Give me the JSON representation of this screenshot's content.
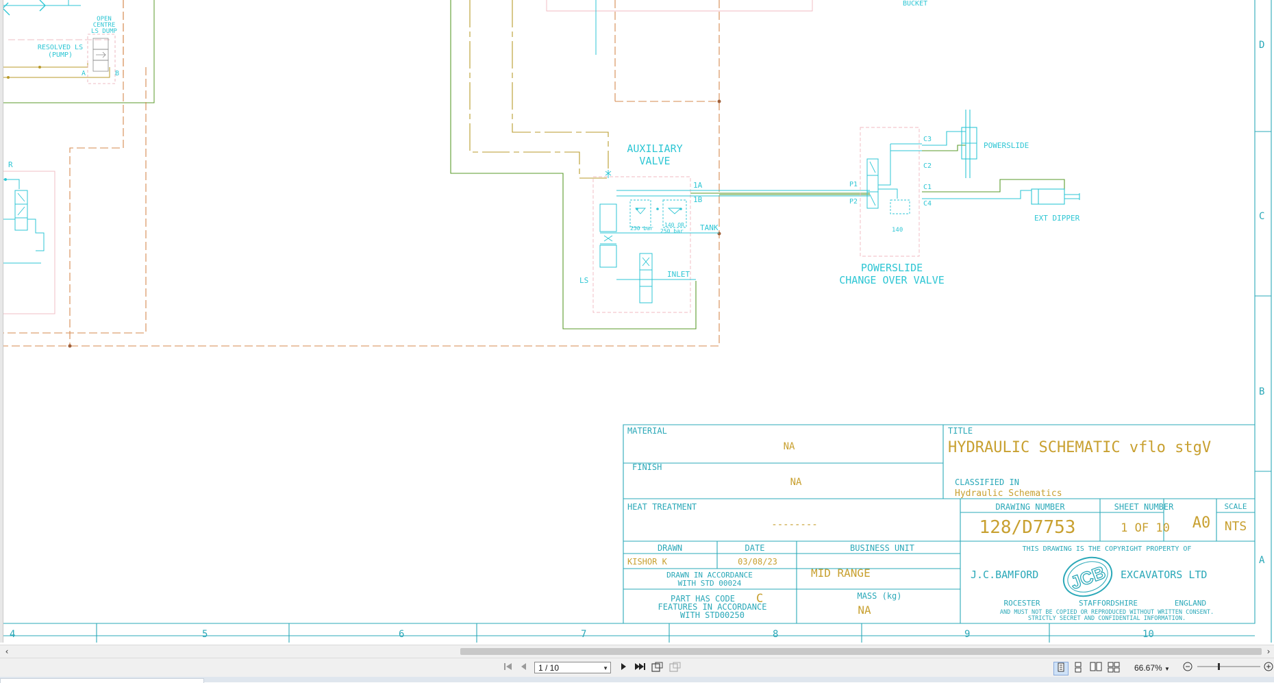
{
  "colors": {
    "cyan": "#2ec6d4",
    "green": "#5a9a2a",
    "orange_dash": "#d4884e",
    "olive": "#b89a2a",
    "frame": "#2aa8b8",
    "pink": "#f0b8c0",
    "title_text": "#c8a030"
  },
  "schematic": {
    "labels": {
      "bucket": "BUCKET",
      "open_centre_1": "OPEN",
      "open_centre_2": "CENTRE",
      "open_centre_3": "LS DUMP",
      "resolved_ls_1": "RESOLVED LS",
      "resolved_ls_2": "(PUMP)",
      "port_a": "A",
      "port_b": "B",
      "r": "R",
      "aux_valve_1": "AUXILIARY",
      "aux_valve_2": "VALVE",
      "port_1a": "1A",
      "port_1b": "1B",
      "tank": "TANK",
      "inlet": "INLET",
      "ls": "LS",
      "relief_1": "250 bar",
      "relief_2a": "140 OR",
      "relief_2b": "250 bar",
      "powerslide": "POWERSLIDE",
      "ext_dipper": "EXT DIPPER",
      "c3": "C3",
      "c2": "C2",
      "c1": "C1",
      "c4": "C4",
      "p1": "P1",
      "p2": "P2",
      "v140": "140",
      "co_valve_1": "POWERSLIDE",
      "co_valve_2": "CHANGE OVER VALVE"
    }
  },
  "grid": {
    "columns": [
      "4",
      "5",
      "6",
      "7",
      "8",
      "9",
      "10"
    ],
    "rows": [
      "D",
      "C",
      "B",
      "A"
    ]
  },
  "title_block": {
    "material_label": "MATERIAL",
    "material_value": "NA",
    "finish_label": "FINISH",
    "finish_value": "NA",
    "heat_label": "HEAT TREATMENT",
    "heat_value": "--------",
    "drawn_label": "DRAWN",
    "drawn_value": "KISHOR K",
    "date_label": "DATE",
    "date_value": "03/08/23",
    "bu_label": "BUSINESS UNIT",
    "bu_value": "MID RANGE",
    "accordance_1": "DRAWN IN ACCORDANCE",
    "accordance_2": "WITH STD 00024",
    "part_code_label": "PART HAS CODE",
    "part_code_value": "C",
    "features_1": "FEATURES IN ACCORDANCE",
    "features_2": "WITH STD00250",
    "mass_label": "MASS (kg)",
    "mass_value": "NA",
    "title_label": "TITLE",
    "title_value": "HYDRAULIC SCHEMATIC vflo stgV",
    "classified_label": "CLASSIFIED IN",
    "classified_value": "Hydraulic Schematics",
    "drawing_number_label": "DRAWING NUMBER",
    "drawing_number_value": "128/D7753",
    "sheet_number_label": "SHEET NUMBER",
    "sheet_number_value": "1 OF 10",
    "size_value": "A0",
    "scale_label": "SCALE",
    "scale_value": "NTS",
    "copyright_line": "THIS DRAWING IS THE COPYRIGHT PROPERTY OF",
    "company_left": "J.C.BAMFORD",
    "company_right": "EXCAVATORS LTD",
    "logo_text": "JCB",
    "address_1": "ROCESTER",
    "address_2": "STAFFORDSHIRE",
    "address_3": "ENGLAND",
    "notice_1": "AND MUST NOT BE COPIED OR REPRODUCED WITHOUT WRITTEN CONSENT.",
    "notice_2": "STRICTLY SECRET AND CONFIDENTIAL INFORMATION."
  },
  "viewer": {
    "page_field": "1 / 10",
    "zoom": "66.67%",
    "icons": [
      "first-page-icon",
      "prev-page-icon",
      "next-page-icon",
      "last-page-icon",
      "single-page-view-icon",
      "continuous-view-icon",
      "facing-view-icon",
      "continuous-facing-view-icon",
      "zoom-out-icon",
      "zoom-in-icon"
    ]
  }
}
